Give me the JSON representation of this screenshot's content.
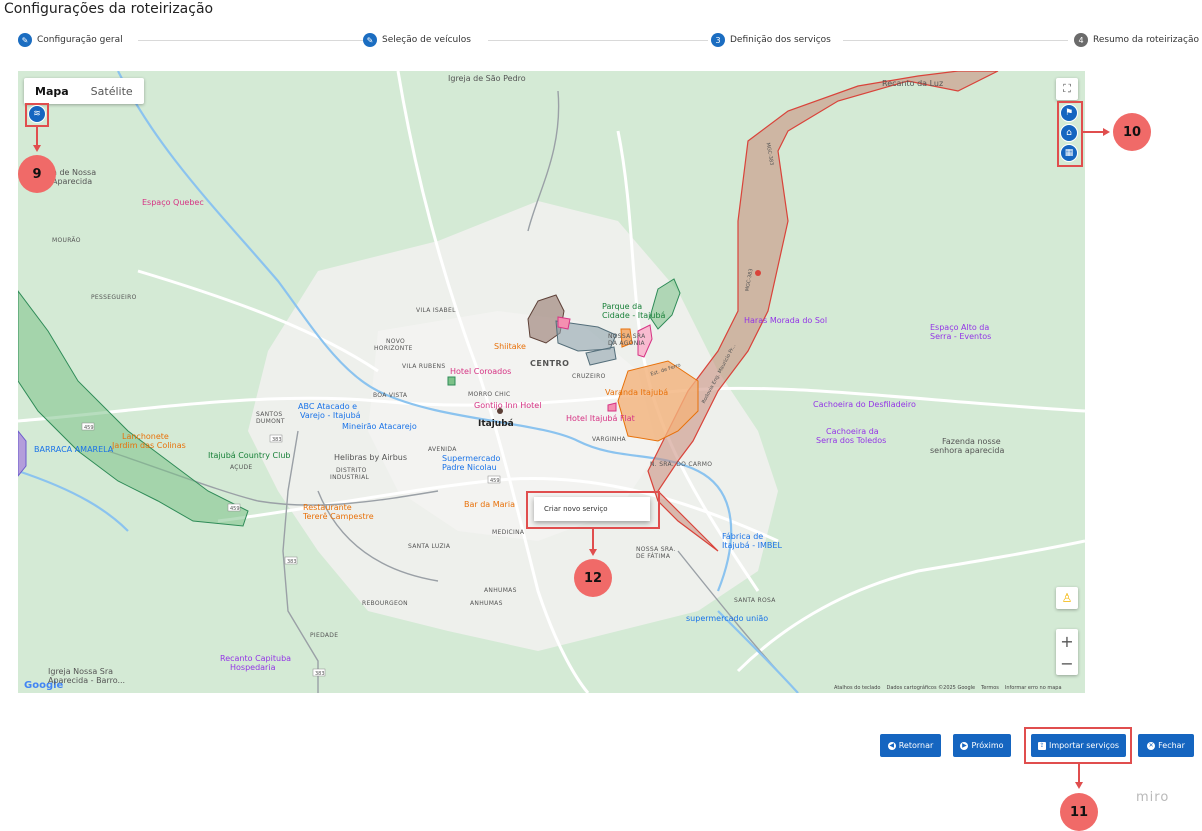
{
  "page": {
    "title": "Configurações da roteirização"
  },
  "stepper": [
    {
      "num": "",
      "label": "Configuração geral",
      "state": "edit"
    },
    {
      "num": "",
      "label": "Seleção de veículos",
      "state": "edit"
    },
    {
      "num": "3",
      "label": "Definição dos serviços",
      "state": "active"
    },
    {
      "num": "4",
      "label": "Resumo da roteirização",
      "state": "pending"
    }
  ],
  "map": {
    "tabs": {
      "map": "Mapa",
      "satellite": "Satélite"
    },
    "context_menu": "Criar novo serviço",
    "zoom_in": "+",
    "zoom_out": "−",
    "attribution": {
      "shortcuts": "Atalhos do teclado",
      "data": "Dados cartográficos ©2025 Google",
      "terms": "Termos",
      "report": "Informar erro no mapa"
    },
    "google": "Google",
    "places": {
      "igreja_sao_pedro": "Igreja de São Pedro",
      "recanto_luz": "Recanto da Luz",
      "nossa_aparecida_1": "a de Nossa",
      "nossa_aparecida_2": "Aparecida",
      "espaco_quebec": "Espaço Quebec",
      "mourao": "MOURÃO",
      "pesqueiro": "PESSEGUEIRO",
      "parque_cidade_1": "Parque da",
      "parque_cidade_2": "Cidade - Itajubá",
      "haras": "Haras Morada do Sol",
      "espaco_alto_1": "Espaço Alto da",
      "espaco_alto_2": "Serra - Eventos",
      "shiitake": "Shiitake",
      "centro": "CENTRO",
      "nossa_agonia_1": "NOSSA SRA",
      "nossa_agonia_2": "DA AGONIA",
      "vila_isabel": "VILA ISABEL",
      "novo_horizonte_1": "NOVO",
      "novo_horizonte_2": "HORIZONTE",
      "vila_rubens": "VILA RUBENS",
      "hotel_coroados": "Hotel Coroados",
      "varanda": "Varanda Itajubá",
      "cruzeiro": "CRUZEIRO",
      "morro_chic": "MORRO CHIC",
      "boa_vista": "BOA VISTA",
      "gontijo": "Gontijo Inn Hotel",
      "hotel_flat": "Hotel Itajubá Flat",
      "cachoeira_desf": "Cachoeira do Desfiladeiro",
      "abc_1": "ABC Atacado e",
      "abc_2": "Varejo - Itajubá",
      "santos_dumont_1": "SANTOS",
      "santos_dumont_2": "DUMONT",
      "mineirao": "Mineirão Atacarejo",
      "itajuba": "Itajubá",
      "varginha": "VARGINHA",
      "cachoeira_toledos_1": "Cachoeira da",
      "cachoeira_toledos_2": "Serra dos Toledos",
      "fazenda_1": "Fazenda nosse",
      "fazenda_2": "senhora aparecida",
      "lanchonete_1": "Lanchonete",
      "lanchonete_2": "Jardim das Colinas",
      "barraca": "BARRACA AMARELA",
      "country_club": "Itajubá Country Club",
      "acude": "AÇUDE",
      "helibras": "Helibras by Airbus",
      "distrito_1": "DISTRITO",
      "distrito_2": "INDUSTRIAL",
      "avenida": "AVENIDA",
      "supermercado_1": "Supermercado",
      "supermercado_2": "Padre Nicolau",
      "sao_carmo": "N. SRA. DO CARMO",
      "restaurante_1": "Restaurante",
      "restaurante_2": "Tererê Campestre",
      "bar_maria": "Bar da Maria",
      "medicina": "MEDICINA",
      "fabrica_1": "Fábrica de",
      "fabrica_2": "Itajubá - IMBEL",
      "nossa_fatima_1": "NOSSA SRA.",
      "nossa_fatima_2": "DE FÁTIMA",
      "santa_luzia": "SANTA LUZIA",
      "anhumas_1": "ANHUMAS",
      "anhumas_2": "ANHUMAS",
      "rebourgeon": "REBOURGEON",
      "santa_rosa": "SANTA ROSA",
      "supermercado_uniao": "supermercado união",
      "piedade": "PIEDADE",
      "recanto_capituba_1": "Recanto Capituba",
      "recanto_capituba_2": "Hospedaria",
      "igreja_nossa_1": "Igreja Nossa Sra",
      "igreja_nossa_2": "Aparecida - Barro...",
      "estrada_ferro": "Est. de Ferro",
      "rod_1": "Rodovia Eng. Mauricio Pr...",
      "mgc_1": "MGC-383",
      "mgc_2": "MGC-383"
    }
  },
  "annotations": {
    "b9": "9",
    "b10": "10",
    "b11": "11",
    "b12": "12"
  },
  "buttons": {
    "retornar": "Retornar",
    "proximo": "Próximo",
    "importar": "Importar serviços",
    "fechar": "Fechar"
  },
  "watermark": "miro",
  "colors": {
    "accent": "#1565c0",
    "annotation": "#e04e4e",
    "badge": "#f06a68"
  }
}
